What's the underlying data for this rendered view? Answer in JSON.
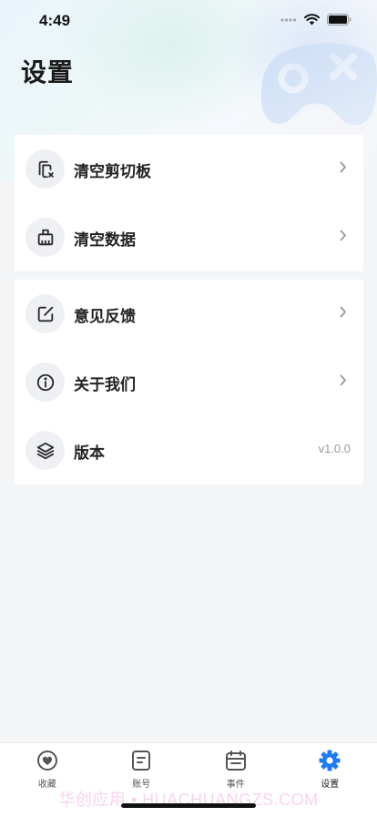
{
  "status_bar": {
    "time": "4:49"
  },
  "page": {
    "title": "设置"
  },
  "groups": [
    {
      "items": [
        {
          "label": "清空剪切板",
          "icon": "clipboard-clear-icon"
        },
        {
          "label": "清空数据",
          "icon": "broom-icon"
        }
      ]
    },
    {
      "items": [
        {
          "label": "意见反馈",
          "icon": "edit-icon"
        },
        {
          "label": "关于我们",
          "icon": "info-icon"
        },
        {
          "label": "版本",
          "icon": "layers-icon",
          "value": "v1.0.0"
        }
      ]
    }
  ],
  "tab_bar": {
    "active": "设置",
    "accent_color": "#1f7cf0",
    "tabs": [
      {
        "label": "收藏",
        "icon": "heart-icon"
      },
      {
        "label": "账号",
        "icon": "document-icon"
      },
      {
        "label": "事件",
        "icon": "calendar-icon"
      },
      {
        "label": "设置",
        "icon": "gear-icon"
      }
    ]
  },
  "watermark": "华创应用 • HUACHUANGZS.COM"
}
